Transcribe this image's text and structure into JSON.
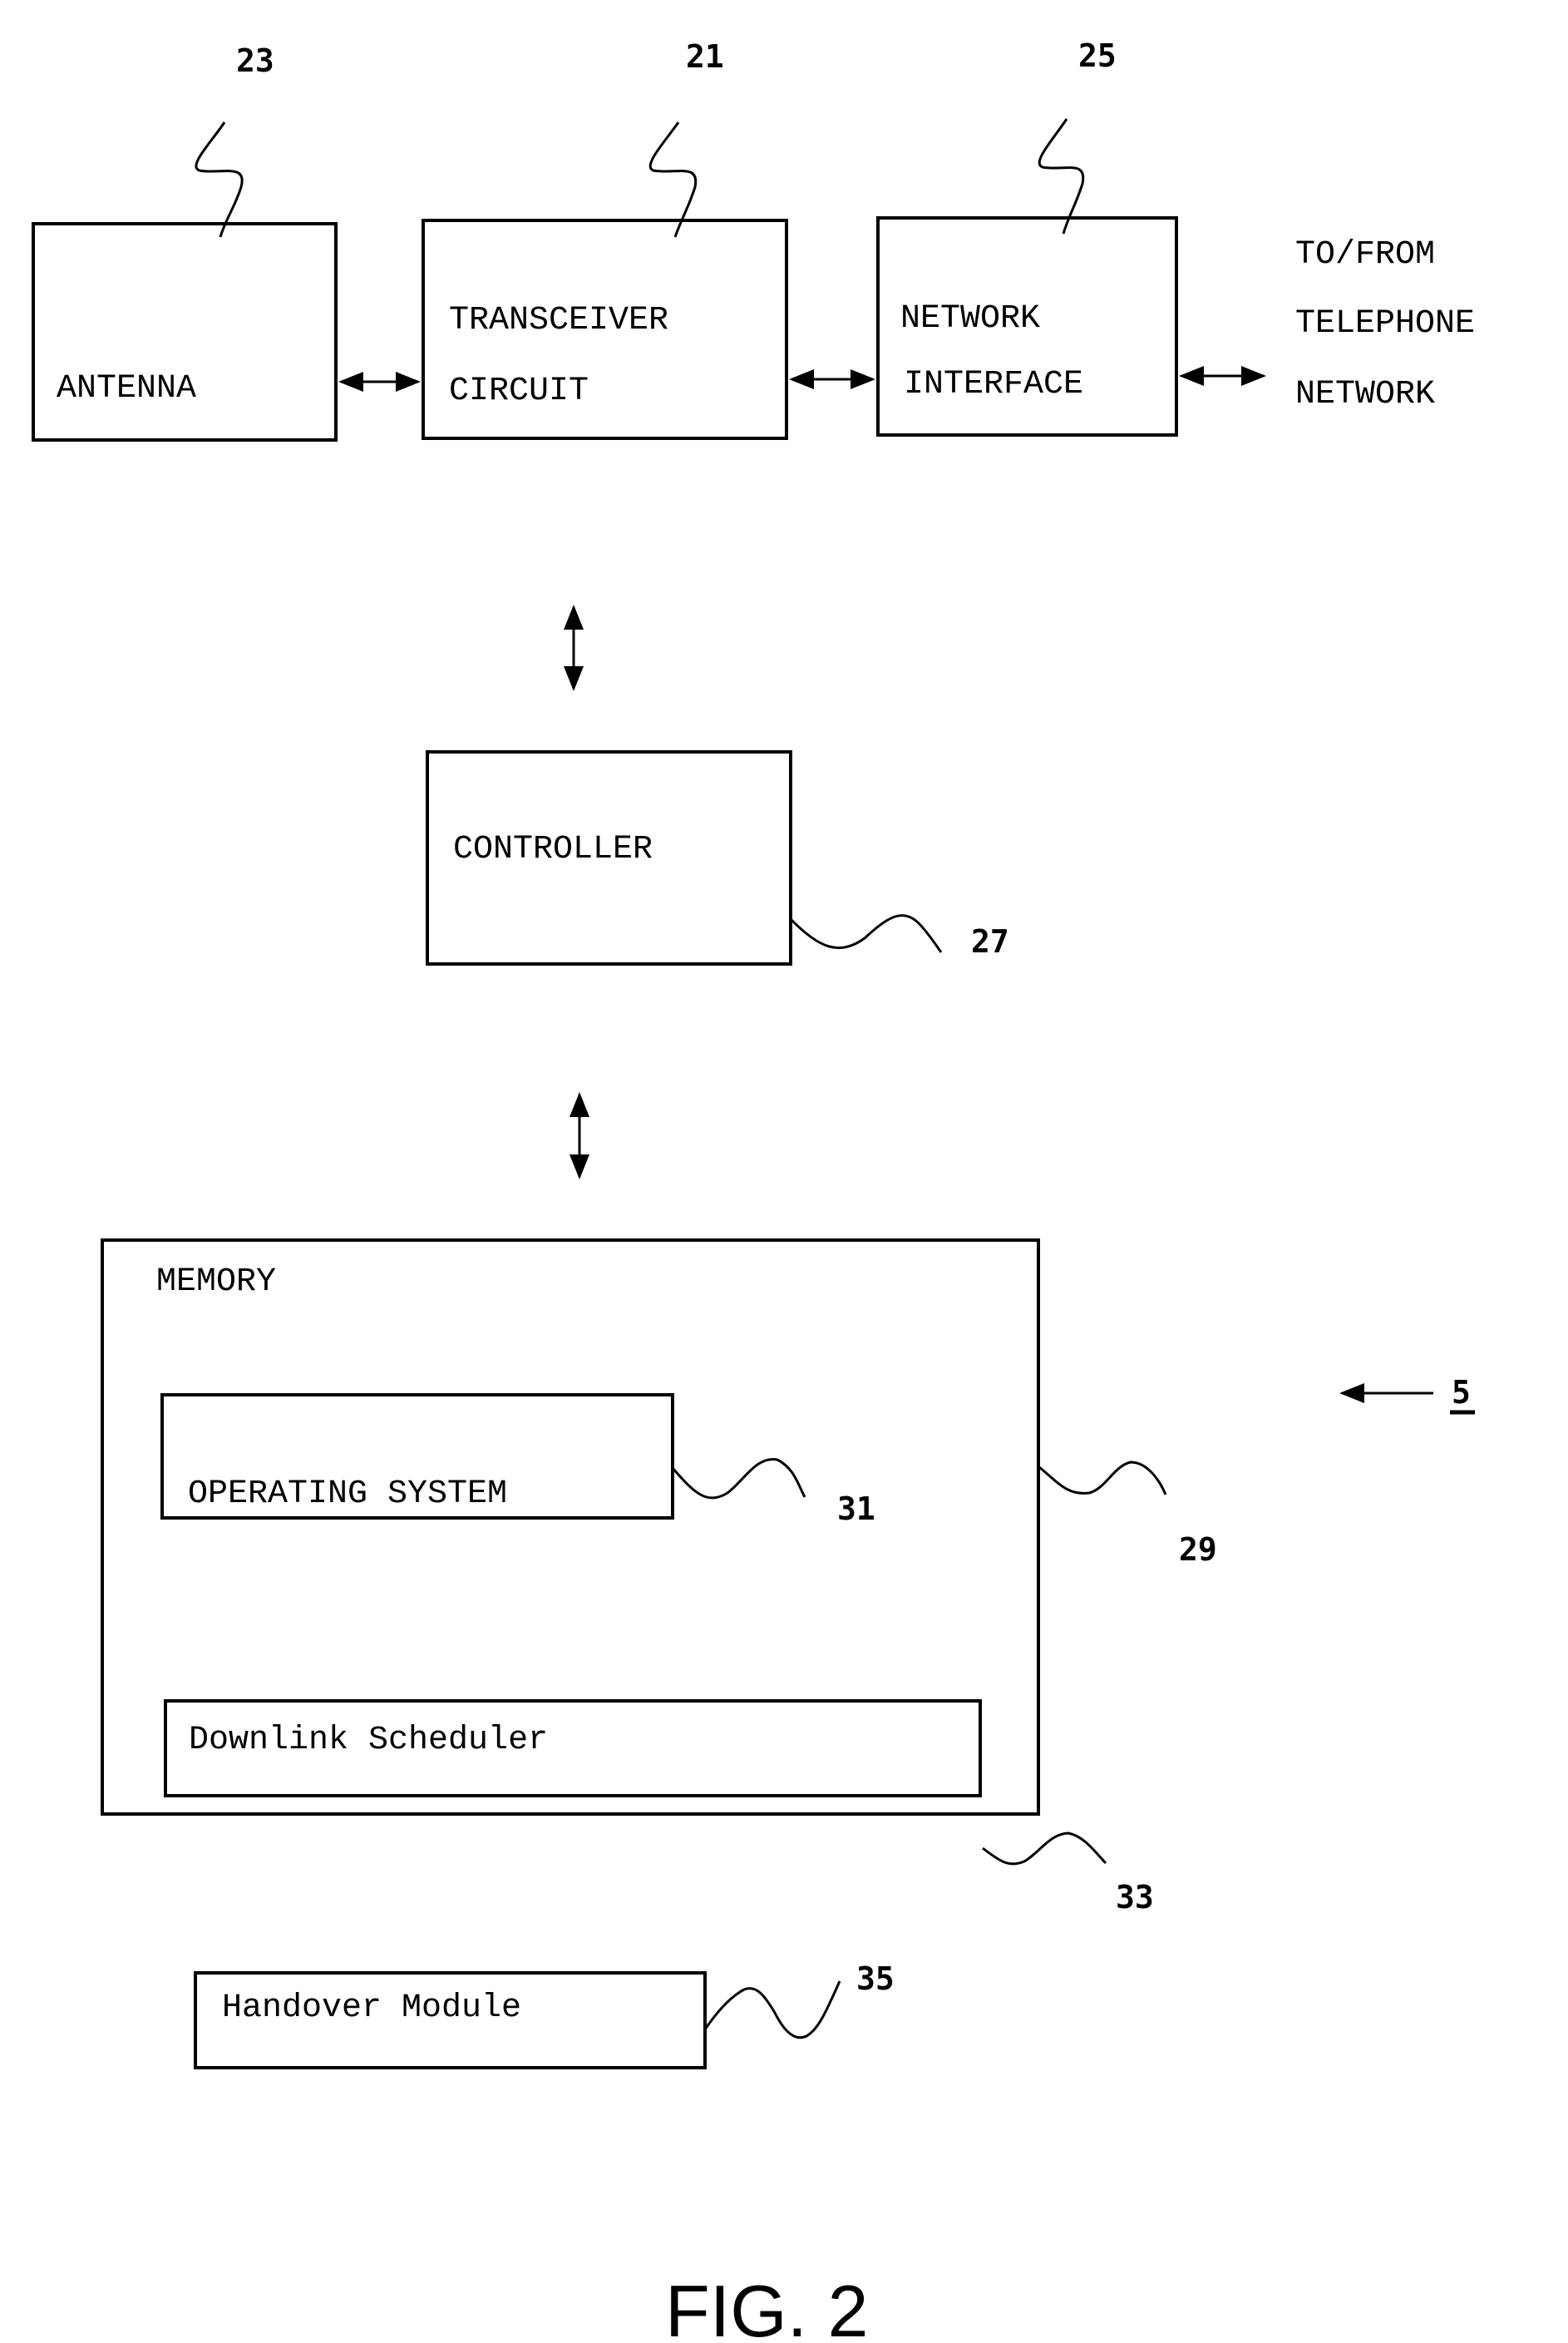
{
  "figure": {
    "caption": "FIG. 2",
    "overall_reference": "5"
  },
  "blocks": {
    "antenna": {
      "label": "ANTENNA",
      "ref": "23"
    },
    "transceiver": {
      "label_line1": "TRANSCEIVER",
      "label_line2": "CIRCUIT",
      "ref": "21"
    },
    "network_interface": {
      "label_line1": "NETWORK",
      "label_line2": "INTERFACE",
      "ref": "25"
    },
    "external": {
      "line1": "TO/FROM",
      "line2": "TELEPHONE",
      "line3": "NETWORK"
    },
    "controller": {
      "label": "CONTROLLER",
      "ref": "27"
    },
    "memory": {
      "label": "MEMORY",
      "ref": "29"
    },
    "operating_system": {
      "label": "OPERATING SYSTEM",
      "ref": "31"
    },
    "downlink_scheduler": {
      "label": "Downlink Scheduler",
      "ref": "33"
    },
    "handover_module": {
      "label": "Handover Module",
      "ref": "35"
    }
  },
  "connections": [
    {
      "from": "antenna",
      "to": "transceiver",
      "type": "bidirectional"
    },
    {
      "from": "transceiver",
      "to": "network_interface",
      "type": "bidirectional"
    },
    {
      "from": "network_interface",
      "to": "external",
      "type": "bidirectional"
    },
    {
      "from": "transceiver",
      "to": "controller",
      "type": "bidirectional"
    },
    {
      "from": "controller",
      "to": "memory",
      "type": "bidirectional"
    }
  ]
}
